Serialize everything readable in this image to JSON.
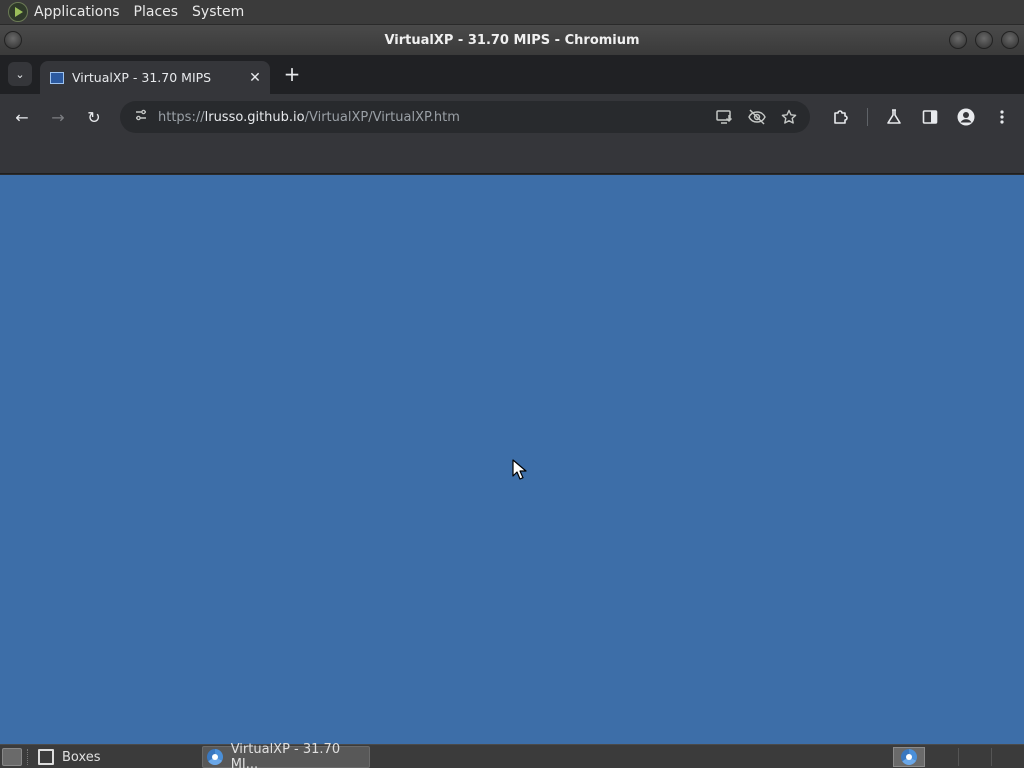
{
  "top_panel": {
    "menus": [
      "Applications",
      "Places",
      "System"
    ]
  },
  "window": {
    "title": "VirtualXP - 31.70 MIPS - Chromium"
  },
  "browser": {
    "tab": {
      "title": "VirtualXP - 31.70 MIPS",
      "close_glyph": "✕"
    },
    "new_tab_glyph": "+",
    "tab_search_glyph": "⌄",
    "nav": {
      "back_glyph": "←",
      "forward_glyph": "→",
      "reload_glyph": "↻"
    },
    "omnibox": {
      "scheme": "https://",
      "host": "lrusso.github.io",
      "path": "/VirtualXP/VirtualXP.htm"
    }
  },
  "page": {
    "background": "#3d6ea8"
  },
  "taskbar": {
    "items": [
      {
        "label": "Boxes",
        "icon": "boxes-icon"
      },
      {
        "label": "VirtualXP - 31.70 MI...",
        "icon": "chromium-icon",
        "active": true
      }
    ]
  }
}
